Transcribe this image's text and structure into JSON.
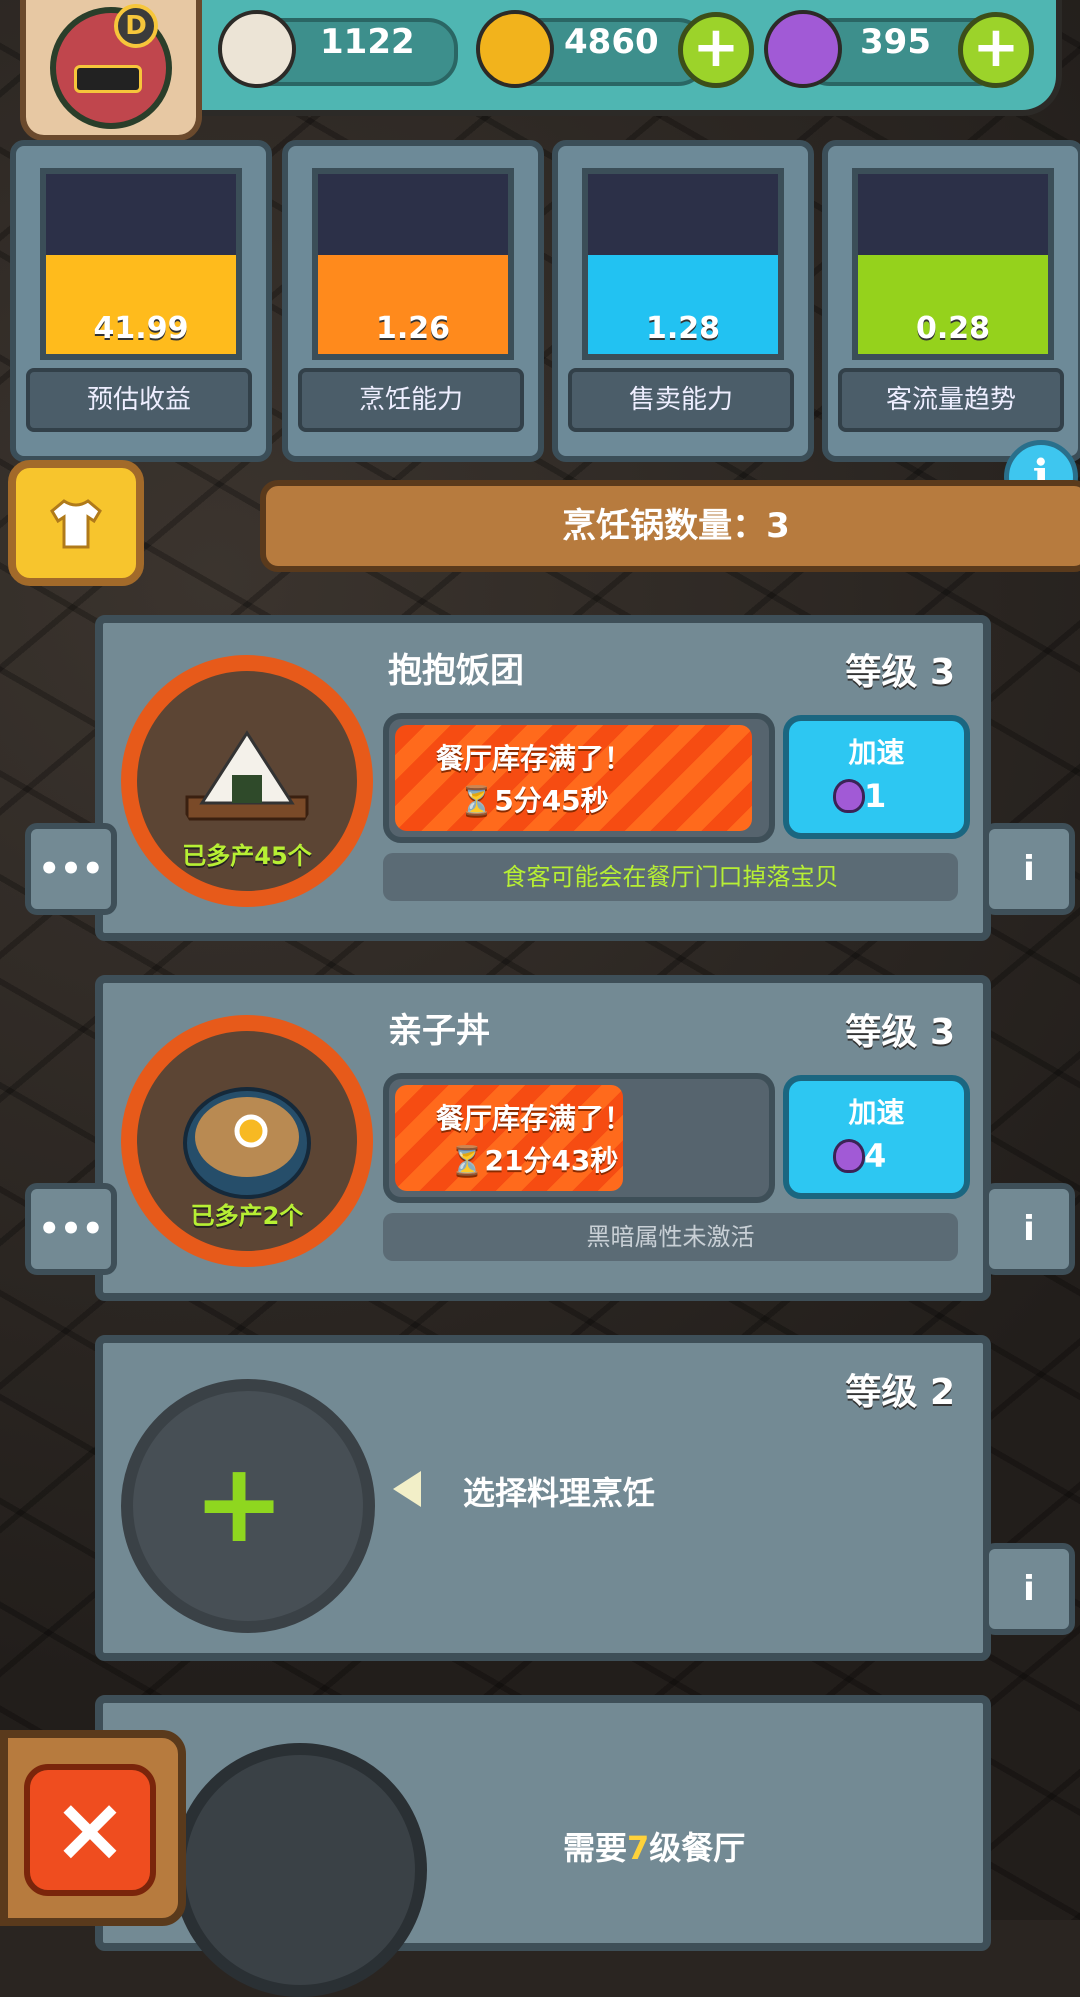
{
  "resources": [
    {
      "icon": "eyeball-icon",
      "value": "1122",
      "color": "#e9e0d0"
    },
    {
      "icon": "coin-icon",
      "value": "4860",
      "color": "#f2b31c"
    },
    {
      "icon": "potion-icon",
      "value": "395",
      "color": "#a15ad6"
    }
  ],
  "avatar_rank": "D",
  "meters": [
    {
      "value": "41.99",
      "label": "预估收益",
      "color": "#ffbb1c",
      "fill": 0.55
    },
    {
      "value": "1.26",
      "label": "烹饪能力",
      "color": "#ff8a1c",
      "fill": 0.55
    },
    {
      "value": "1.28",
      "label": "售卖能力",
      "color": "#22c2f2",
      "fill": 0.55
    },
    {
      "value": "0.28",
      "label": "客流量趋势",
      "color": "#95d21c",
      "fill": 0.55
    }
  ],
  "banner": {
    "pot_count_label": "烹饪锅数量：3"
  },
  "cards": [
    {
      "name": "抱抱饭团",
      "level": "等级 3",
      "count": "已多产45个",
      "status": "餐厅库存满了！",
      "timer": "⏳5分45秒",
      "progress": 0.97,
      "boost_label": "加速",
      "boost_cost": "1",
      "hint": "食客可能会在餐厅门口掉落宝贝",
      "hint_color": "#b7ef34"
    },
    {
      "name": "亲子丼",
      "level": "等级 3",
      "count": "已多产2个",
      "status": "餐厅库存满了！",
      "timer": "⏳21分43秒",
      "progress": 0.62,
      "boost_label": "加速",
      "boost_cost": "4",
      "hint": "黑暗属性未激活",
      "hint_color": "#c9d0d6"
    }
  ],
  "empty_slot": {
    "level": "等级 2",
    "action": "选择料理烹饪"
  },
  "locked_slot": {
    "req_prefix": "需要",
    "req_num": "7",
    "req_suffix": "级餐厅"
  },
  "side_tab_more": "•••",
  "side_tab_info": "i",
  "info_icon": "i",
  "close_icon": "×",
  "plus_icon": "+"
}
